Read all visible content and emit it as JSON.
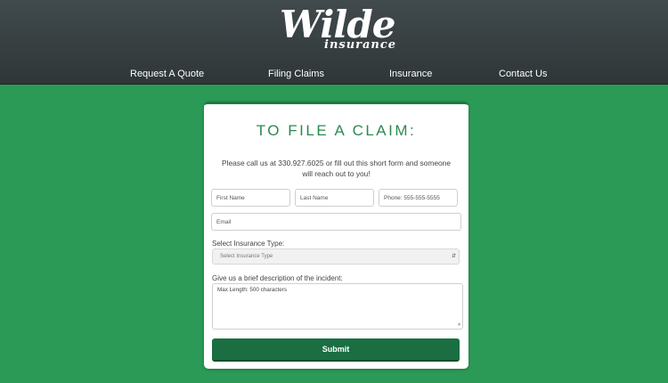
{
  "brand": {
    "logo_main": "Wilde",
    "logo_sub": "insurance"
  },
  "nav": {
    "items": [
      {
        "label": "Request A Quote"
      },
      {
        "label": "Filing Claims"
      },
      {
        "label": "Insurance"
      },
      {
        "label": "Contact Us"
      }
    ]
  },
  "claim_form": {
    "title": "TO FILE A CLAIM:",
    "intro": "Please call us at 330.927.6025 or fill out this short form and someone will reach out to you!",
    "first_name_placeholder": "First Name",
    "last_name_placeholder": "Last Name",
    "phone_placeholder": "Phone: 555-555-5555",
    "email_placeholder": "Email",
    "insurance_type_label": "Select Insurance Type:",
    "insurance_type_selected": "Select Insurance Type",
    "description_label": "Give us a brief description of the incident:",
    "description_placeholder": "Max Length: 500 characters",
    "submit_label": "Submit"
  },
  "colors": {
    "background": "#2a9a56",
    "header": "#363e41",
    "accent": "#2a8a4e",
    "button": "#1a6e42"
  }
}
